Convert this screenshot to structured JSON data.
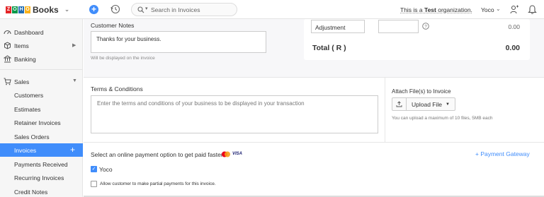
{
  "app": {
    "logo_letters": [
      "Z",
      "O",
      "H",
      "O"
    ],
    "logo_colors": [
      "#e42527",
      "#089949",
      "#226db4",
      "#f9b21d"
    ],
    "product_name": "Books",
    "accent_color": "#408dfb"
  },
  "header": {
    "search_placeholder": "Search in Invoices",
    "org_prefix": "This is a ",
    "org_bold": "Test",
    "org_suffix": " organization.",
    "user_name": "Yoco",
    "icons": [
      "plus-circle-icon",
      "history-icon",
      "search-icon",
      "users-icon",
      "bell-icon"
    ]
  },
  "sidebar": {
    "items": [
      {
        "label": "Dashboard",
        "icon": "dashboard-icon"
      },
      {
        "label": "Items",
        "icon": "items-icon"
      },
      {
        "label": "Banking",
        "icon": "bank-icon"
      }
    ],
    "sales": {
      "label": "Sales",
      "icon": "cart-icon",
      "children": [
        {
          "label": "Customers"
        },
        {
          "label": "Estimates"
        },
        {
          "label": "Retainer Invoices"
        },
        {
          "label": "Sales Orders"
        },
        {
          "label": "Invoices",
          "active": true
        },
        {
          "label": "Payments Received"
        },
        {
          "label": "Recurring Invoices"
        },
        {
          "label": "Credit Notes"
        }
      ]
    }
  },
  "notes": {
    "label": "Customer Notes",
    "value": "Thanks for your business.",
    "hint": "Will be displayed on the invoice"
  },
  "totals": {
    "adjustment_label": "Adjustment",
    "adjustment_value": "0.00",
    "total_label": "Total ( R )",
    "total_value": "0.00"
  },
  "terms": {
    "label": "Terms & Conditions",
    "placeholder": "Enter the terms and conditions of your business to be displayed in your transaction"
  },
  "attach": {
    "label": "Attach File(s) to Invoice",
    "upload_label": "Upload File",
    "hint": "You can upload a maximum of 10 files, 5MB each"
  },
  "payment": {
    "prompt": "Select an online payment option to get paid faster",
    "visa_text": "VISA",
    "gateway_link": "+ Payment Gateway",
    "yoco_label": "Yoco",
    "yoco_checked": true,
    "partial_label": "Allow customer to make partial payments for this invoice.",
    "partial_checked": false
  }
}
